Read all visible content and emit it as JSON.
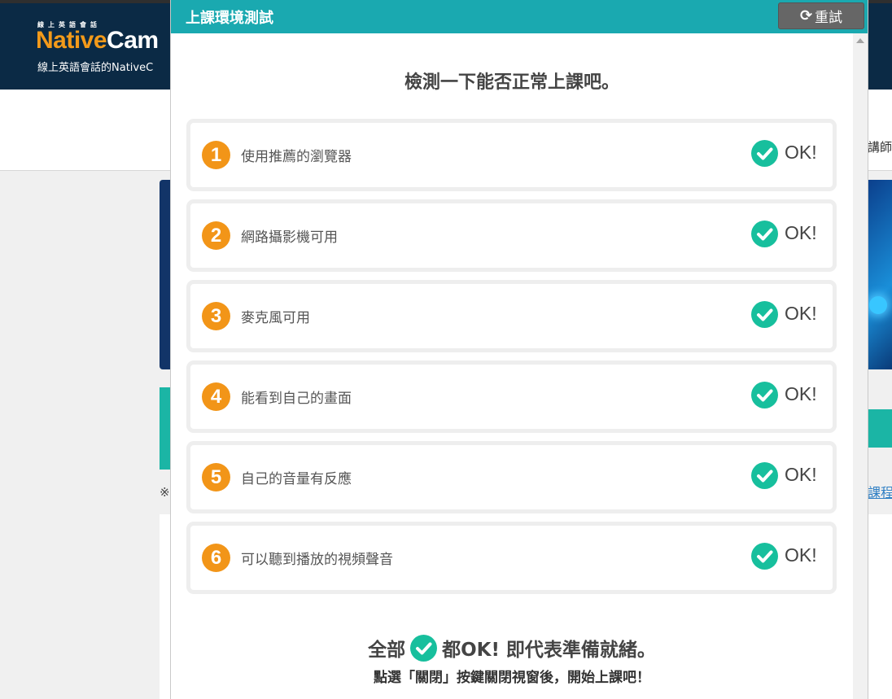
{
  "background": {
    "logo_small": "線上英語會話",
    "logo_brand_orange": "Native",
    "logo_brand_white": "Cam",
    "logo_tagline": "線上英語會話的NativeC",
    "nav_right_text": "講師",
    "note_mark": "※",
    "link_right_text": "課程"
  },
  "modal": {
    "title": "上課環境測試",
    "retry_label": "重試",
    "retry_icon": "refresh-icon",
    "intro": "檢測一下能否正常上課吧。",
    "items": [
      {
        "number": "1",
        "label": "使用推薦的瀏覽器",
        "status": "OK!"
      },
      {
        "number": "2",
        "label": "網路攝影機可用",
        "status": "OK!"
      },
      {
        "number": "3",
        "label": "麥克風可用",
        "status": "OK!"
      },
      {
        "number": "4",
        "label": "能看到自己的畫面",
        "status": "OK!"
      },
      {
        "number": "5",
        "label": "自己的音量有反應",
        "status": "OK!"
      },
      {
        "number": "6",
        "label": "可以聽到播放的視頻聲音",
        "status": "OK!"
      }
    ],
    "summary_prefix": "全部",
    "summary_suffix": "都OK! 即代表準備就緒。",
    "instruction": "點選「關閉」按鍵關閉視窗後，開始上課吧！"
  },
  "colors": {
    "header_teal": "#1aa9b0",
    "number_orange": "#f29518",
    "check_green": "#17bf9d",
    "retry_gray": "#666666",
    "page_navy": "#0b2a45"
  }
}
